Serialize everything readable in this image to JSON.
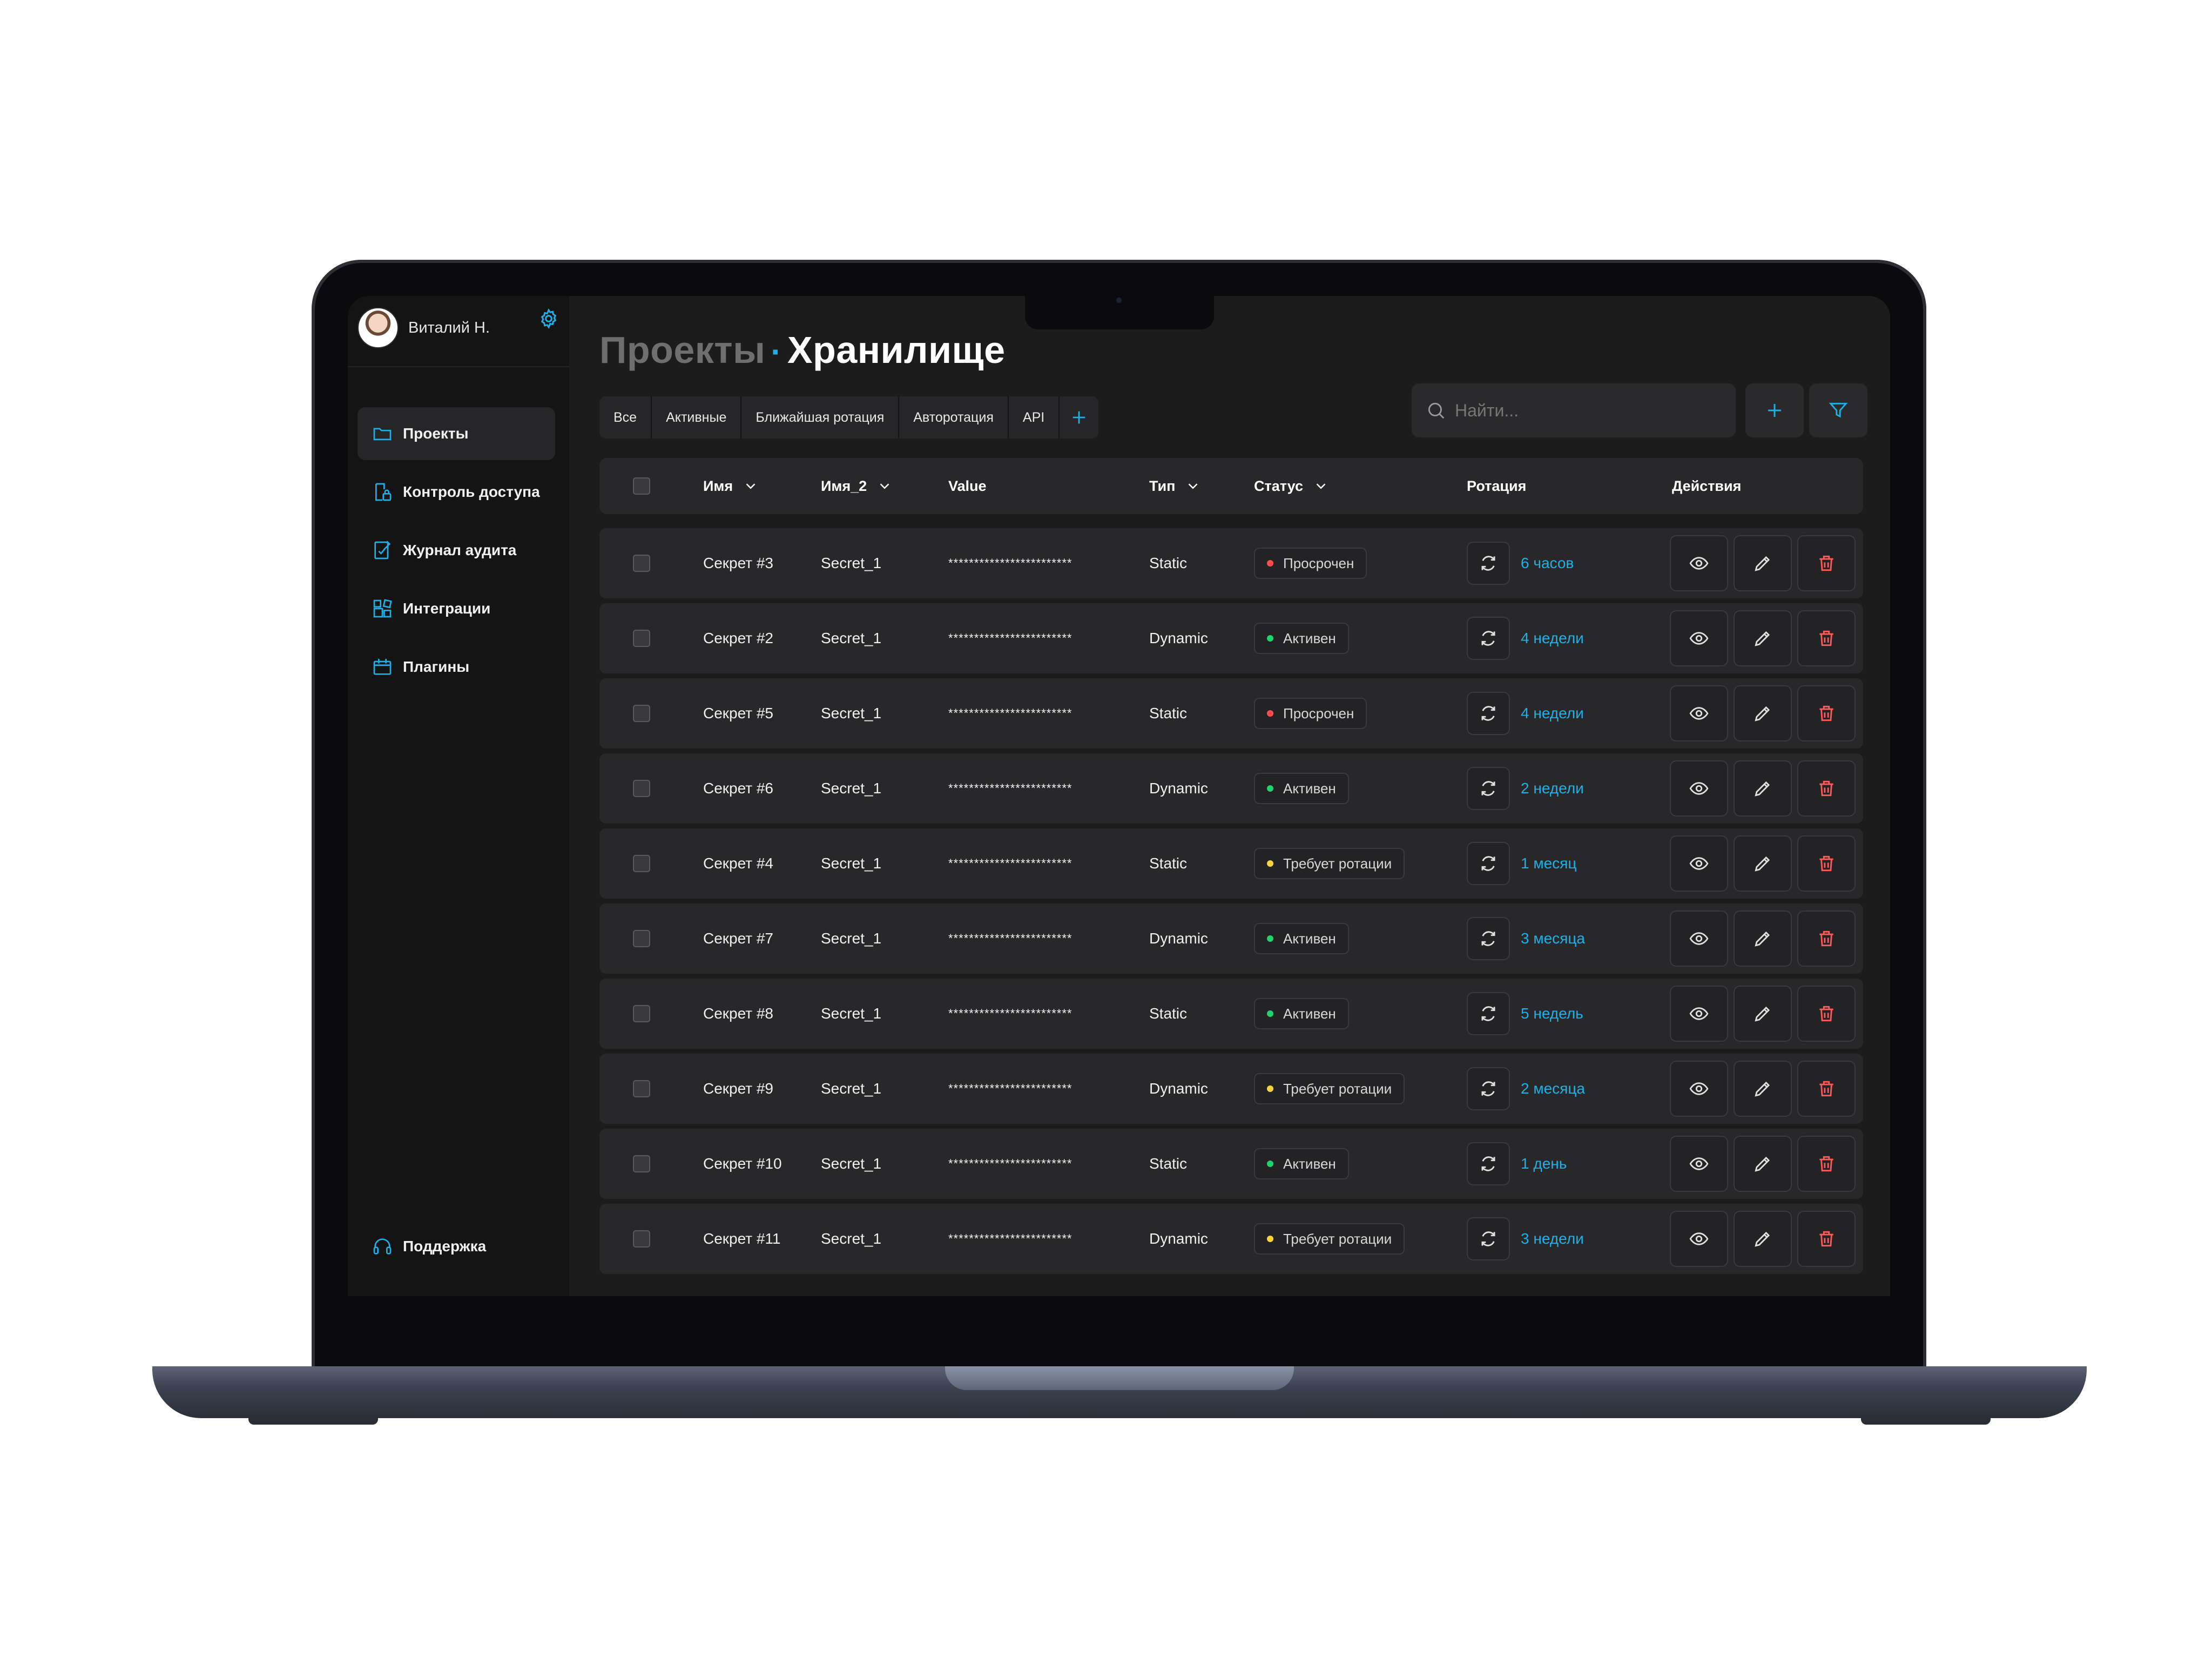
{
  "user": {
    "name": "Виталий Н."
  },
  "sidebar": {
    "items": [
      {
        "label": "Проекты",
        "icon": "folder-icon"
      },
      {
        "label": "Контроль доступа",
        "icon": "access-control-icon"
      },
      {
        "label": "Журнал аудита",
        "icon": "audit-log-icon"
      },
      {
        "label": "Интеграции",
        "icon": "integrations-icon"
      },
      {
        "label": "Плагины",
        "icon": "plugins-icon"
      }
    ],
    "support": "Поддержка"
  },
  "breadcrumb": {
    "parent": "Проекты",
    "separator": "·",
    "current": "Хранилище"
  },
  "tabs": [
    "Все",
    "Активные",
    "Ближайшая ротация",
    "Авторотация",
    "API"
  ],
  "search": {
    "placeholder": "Найти..."
  },
  "table": {
    "columns": [
      "Имя",
      "Имя_2",
      "Value",
      "Тип",
      "Статус",
      "Ротация",
      "Действия"
    ],
    "rows": [
      {
        "name": "Секрет #3",
        "name2": "Secret_1",
        "value": "************************",
        "type": "Static",
        "status": "Просрочен",
        "rotation": "6 часов"
      },
      {
        "name": "Секрет #2",
        "name2": "Secret_1",
        "value": "************************",
        "type": "Dynamic",
        "status": "Активен",
        "rotation": "4 недели"
      },
      {
        "name": "Секрет #5",
        "name2": "Secret_1",
        "value": "************************",
        "type": "Static",
        "status": "Просрочен",
        "rotation": "4 недели"
      },
      {
        "name": "Секрет #6",
        "name2": "Secret_1",
        "value": "************************",
        "type": "Dynamic",
        "status": "Активен",
        "rotation": "2 недели"
      },
      {
        "name": "Секрет #4",
        "name2": "Secret_1",
        "value": "************************",
        "type": "Static",
        "status": "Требует ротации",
        "rotation": "1 месяц"
      },
      {
        "name": "Секрет #7",
        "name2": "Secret_1",
        "value": "************************",
        "type": "Dynamic",
        "status": "Активен",
        "rotation": "3 месяца"
      },
      {
        "name": "Секрет #8",
        "name2": "Secret_1",
        "value": "************************",
        "type": "Static",
        "status": "Активен",
        "rotation": "5 недель"
      },
      {
        "name": "Секрет #9",
        "name2": "Secret_1",
        "value": "************************",
        "type": "Dynamic",
        "status": "Требует ротации",
        "rotation": "2 месяца"
      },
      {
        "name": "Секрет #10",
        "name2": "Secret_1",
        "value": "************************",
        "type": "Static",
        "status": "Активен",
        "rotation": "1 день"
      },
      {
        "name": "Секрет #11",
        "name2": "Secret_1",
        "value": "************************",
        "type": "Dynamic",
        "status": "Требует ротации",
        "rotation": "3 недели"
      }
    ]
  },
  "colors": {
    "accent": "#1fb0e6",
    "status_expired": "#ff4d4f",
    "status_active": "#22d26a",
    "status_needs_rotation": "#ffd33d",
    "delete": "#ff5a5a"
  }
}
